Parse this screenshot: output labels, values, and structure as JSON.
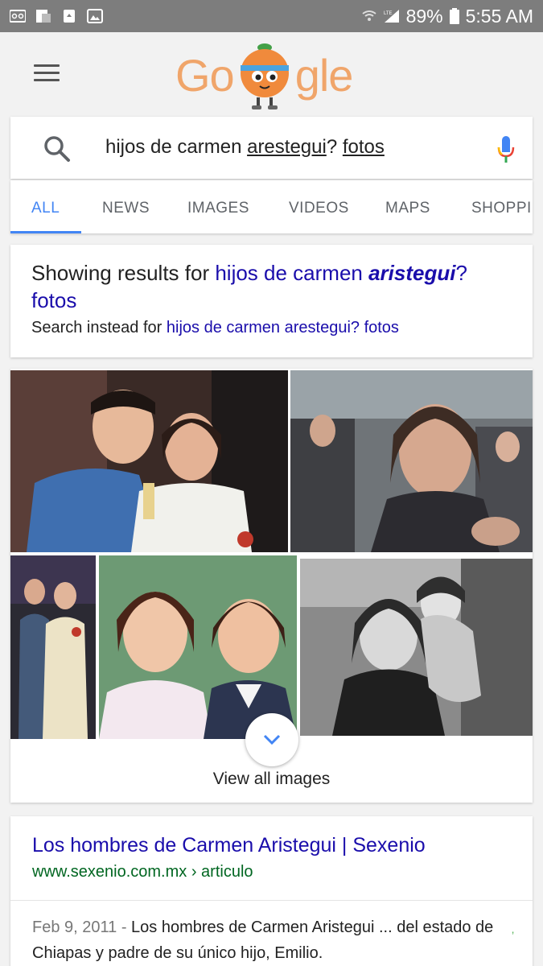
{
  "status_bar": {
    "battery": "89%",
    "time": "5:55 AM",
    "network": "LTE"
  },
  "header": {
    "logo_left": "Go",
    "logo_right": "gle"
  },
  "search": {
    "query_prefix": "hijos de carmen ",
    "query_word1": "arestegui",
    "query_mid": "? ",
    "query_word2": "fotos"
  },
  "tabs": [
    {
      "label": "ALL",
      "active": true
    },
    {
      "label": "NEWS"
    },
    {
      "label": "IMAGES"
    },
    {
      "label": "VIDEOS"
    },
    {
      "label": "MAPS"
    },
    {
      "label": "SHOPPI"
    }
  ],
  "correction": {
    "showing_prefix": "Showing results for ",
    "showing_query_a": "hijos de carmen ",
    "showing_query_bold": "aristegui",
    "showing_query_b": "? fotos",
    "instead_prefix": "Search instead for ",
    "instead_query": "hijos de carmen arestegui? fotos"
  },
  "images": {
    "view_all_label": "View all images"
  },
  "result": {
    "title": "Los hombres de Carmen Aristegui | Sexenio",
    "url": "www.sexenio.com.mx › articulo",
    "date": "Feb 9, 2011",
    "date_sep": " - ",
    "snippet": "Los hombres de Carmen Aristegui ... del estado de Chiapas y padre de su único hijo, Emilio.",
    "tick": "’"
  },
  "colors": {
    "link": "#1a0dab",
    "url_green": "#006621",
    "tab_active": "#4285f4",
    "status_bar": "#7d7d7d"
  }
}
